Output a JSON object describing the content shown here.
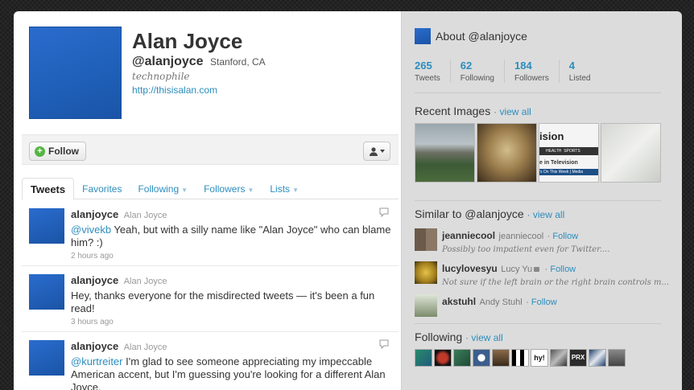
{
  "profile": {
    "name": "Alan Joyce",
    "handle": "@alanjoyce",
    "location": "Stanford, CA",
    "bio": "technophile",
    "url": "http://thisisalan.com"
  },
  "actions": {
    "follow_label": "Follow"
  },
  "tabs": [
    {
      "label": "Tweets"
    },
    {
      "label": "Favorites"
    },
    {
      "label": "Following"
    },
    {
      "label": "Followers"
    },
    {
      "label": "Lists"
    }
  ],
  "tweets": [
    {
      "user": "alanjoyce",
      "fullname": "Alan Joyce",
      "mention": "@vivekb",
      "text": " Yeah, but with a silly name like \"Alan Joyce\" who can blame him? :)",
      "time": "2 hours ago"
    },
    {
      "user": "alanjoyce",
      "fullname": "Alan Joyce",
      "mention": "",
      "text": "Hey, thanks everyone for the misdirected tweets — it's been a fun read!",
      "time": "3 hours ago"
    },
    {
      "user": "alanjoyce",
      "fullname": "Alan Joyce",
      "mention": "@kurtreiter",
      "text": " I'm glad to see someone appreciating my impeccable American accent, but I'm guessing you're looking for a different Alan Joyce.",
      "time": ""
    }
  ],
  "sidebar": {
    "about_title": "About @alanjoyce",
    "stats": [
      {
        "value": "265",
        "label": "Tweets"
      },
      {
        "value": "62",
        "label": "Following"
      },
      {
        "value": "184",
        "label": "Followers"
      },
      {
        "value": "4",
        "label": "Listed"
      }
    ],
    "recent_images_title": "Recent Images",
    "view_all": "view all",
    "image3_text": {
      "title": "ision",
      "nav1": "HEALTH",
      "nav2": "SPORTS",
      "line1": "e in Television",
      "line2": "'s On This Week",
      "line3": "Media"
    },
    "similar_title": "Similar to @alanjoyce",
    "similar": [
      {
        "name": "jeanniecool",
        "full": "jeanniecool",
        "follow": "Follow",
        "desc": "Possibly too impatient even for Twitter...."
      },
      {
        "name": "lucylovesyu",
        "full": "Lucy Yu",
        "follow": "Follow",
        "desc": "Not sure if the left brain or the right brain controls m..."
      },
      {
        "name": "akstuhl",
        "full": "Andy Stuhl",
        "follow": "Follow",
        "desc": ""
      }
    ],
    "following_title": "Following",
    "following_tile_text": {
      "t5": "hy!",
      "t7": "PRX"
    }
  },
  "colors": {
    "link": "#2c8dbd",
    "avatar": "#1f5fb8"
  }
}
